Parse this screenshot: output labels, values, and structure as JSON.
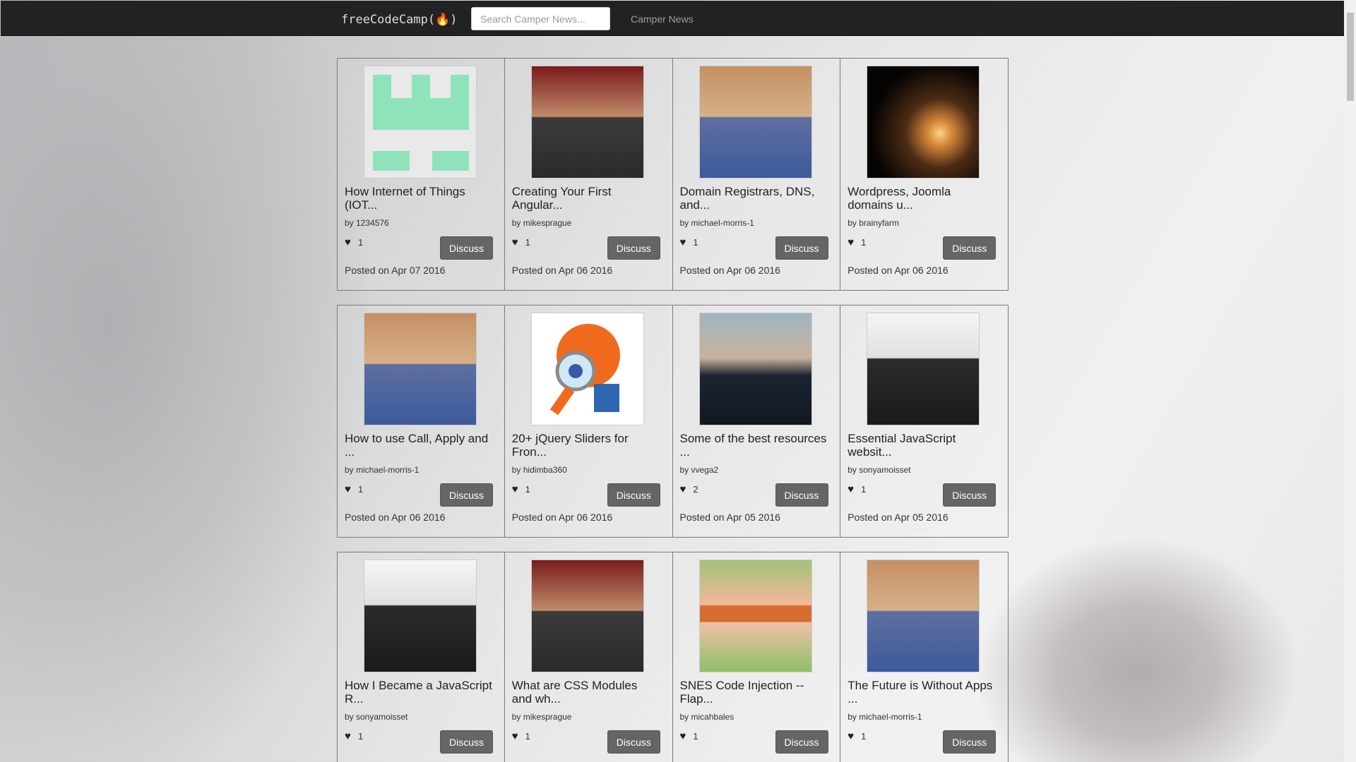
{
  "navbar": {
    "brand": "freeCodeCamp(🔥)",
    "search_placeholder": "Search Camper News...",
    "link": "Camper News"
  },
  "icons": {
    "like": "heart-icon",
    "brand": "fire-icon"
  },
  "colors": {
    "navbar_bg": "#222222",
    "button_bg": "#656565",
    "card_border": "#7a7a7a"
  },
  "posts": [
    {
      "title": "How Internet of Things (IOT...",
      "author": "by 1234576",
      "likes": "1",
      "posted": "Posted on Apr 07 2016",
      "discuss": "Discuss",
      "thumb": "logo"
    },
    {
      "title": "Creating Your First Angular...",
      "author": "by mikesprague",
      "likes": "1",
      "posted": "Posted on Apr 06 2016",
      "discuss": "Discuss",
      "thumb": "person2"
    },
    {
      "title": "Domain Registrars, DNS, and...",
      "author": "by michael-morris-1",
      "likes": "1",
      "posted": "Posted on Apr 06 2016",
      "discuss": "Discuss",
      "thumb": "person"
    },
    {
      "title": "Wordpress, Joomla domains u...",
      "author": "by brainyfarm",
      "likes": "1",
      "posted": "Posted on Apr 06 2016",
      "discuss": "Discuss",
      "thumb": "sunset"
    },
    {
      "title": "How to use Call, Apply and ...",
      "author": "by michael-morris-1",
      "likes": "1",
      "posted": "Posted on Apr 06 2016",
      "discuss": "Discuss",
      "thumb": "person"
    },
    {
      "title": "20+ jQuery Sliders for Fron...",
      "author": "by hidimba360",
      "likes": "1",
      "posted": "Posted on Apr 06 2016",
      "discuss": "Discuss",
      "thumb": "cartoon"
    },
    {
      "title": "Some of the best resources ...",
      "author": "by vvega2",
      "likes": "2",
      "posted": "Posted on Apr 05 2016",
      "discuss": "Discuss",
      "thumb": "glasses"
    },
    {
      "title": "Essential JavaScript websit...",
      "author": "by sonyamoisset",
      "likes": "1",
      "posted": "Posted on Apr 05 2016",
      "discuss": "Discuss",
      "thumb": "bw"
    },
    {
      "title": "How I Became a JavaScript R...",
      "author": "by sonyamoisset",
      "likes": "1",
      "posted": "",
      "discuss": "Discuss",
      "thumb": "bw"
    },
    {
      "title": "What are CSS Modules and wh...",
      "author": "by mikesprague",
      "likes": "1",
      "posted": "",
      "discuss": "Discuss",
      "thumb": "person2"
    },
    {
      "title": "SNES Code Injection -- Flap...",
      "author": "by micahbales",
      "likes": "1",
      "posted": "",
      "discuss": "Discuss",
      "thumb": "red"
    },
    {
      "title": "The Future is Without Apps ...",
      "author": "by michael-morris-1",
      "likes": "1",
      "posted": "",
      "discuss": "Discuss",
      "thumb": "person"
    }
  ]
}
